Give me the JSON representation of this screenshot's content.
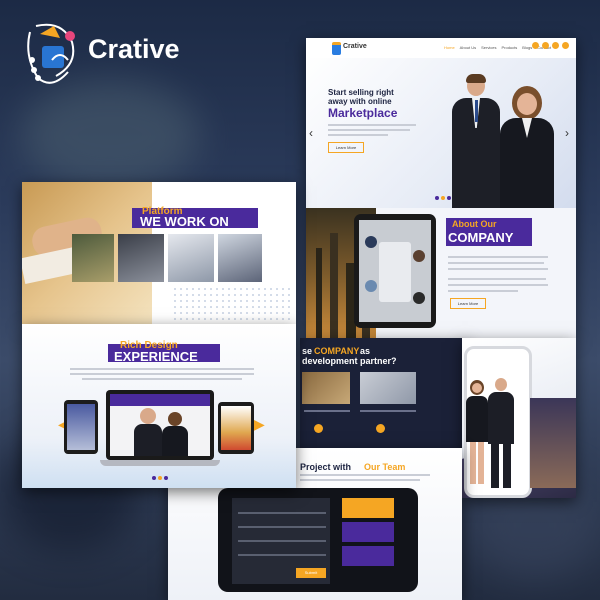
{
  "brand": {
    "name": "Crative",
    "mini_name": "Crative"
  },
  "colors": {
    "purple": "#4a2a9c",
    "orange": "#f5a623",
    "dark": "#1c2340",
    "gold": "#e8a440"
  },
  "nav": {
    "items": [
      "Home",
      "About Us",
      "Services",
      "Products",
      "Blogs",
      "Contact"
    ]
  },
  "hero": {
    "line1": "Start selling right",
    "line2": "away with online",
    "highlight": "Marketplace",
    "button": "Learn More",
    "prev_icon": "chevron-left-icon",
    "next_icon": "chevron-right-icon"
  },
  "about": {
    "small": "About Our",
    "big": "COMPANY",
    "button": "Learn More"
  },
  "platform": {
    "small": "Platform",
    "big": "WE WORK ON"
  },
  "rich": {
    "small": "Rich Design",
    "big": "EXPERIENCE"
  },
  "choose": {
    "pre": "se",
    "highlight": "COMPANY",
    "post": "as",
    "line2": "development partner?"
  },
  "project": {
    "pre": "Project with",
    "highlight": "Our Team"
  },
  "contact_strip": {
    "button": "Submit"
  }
}
